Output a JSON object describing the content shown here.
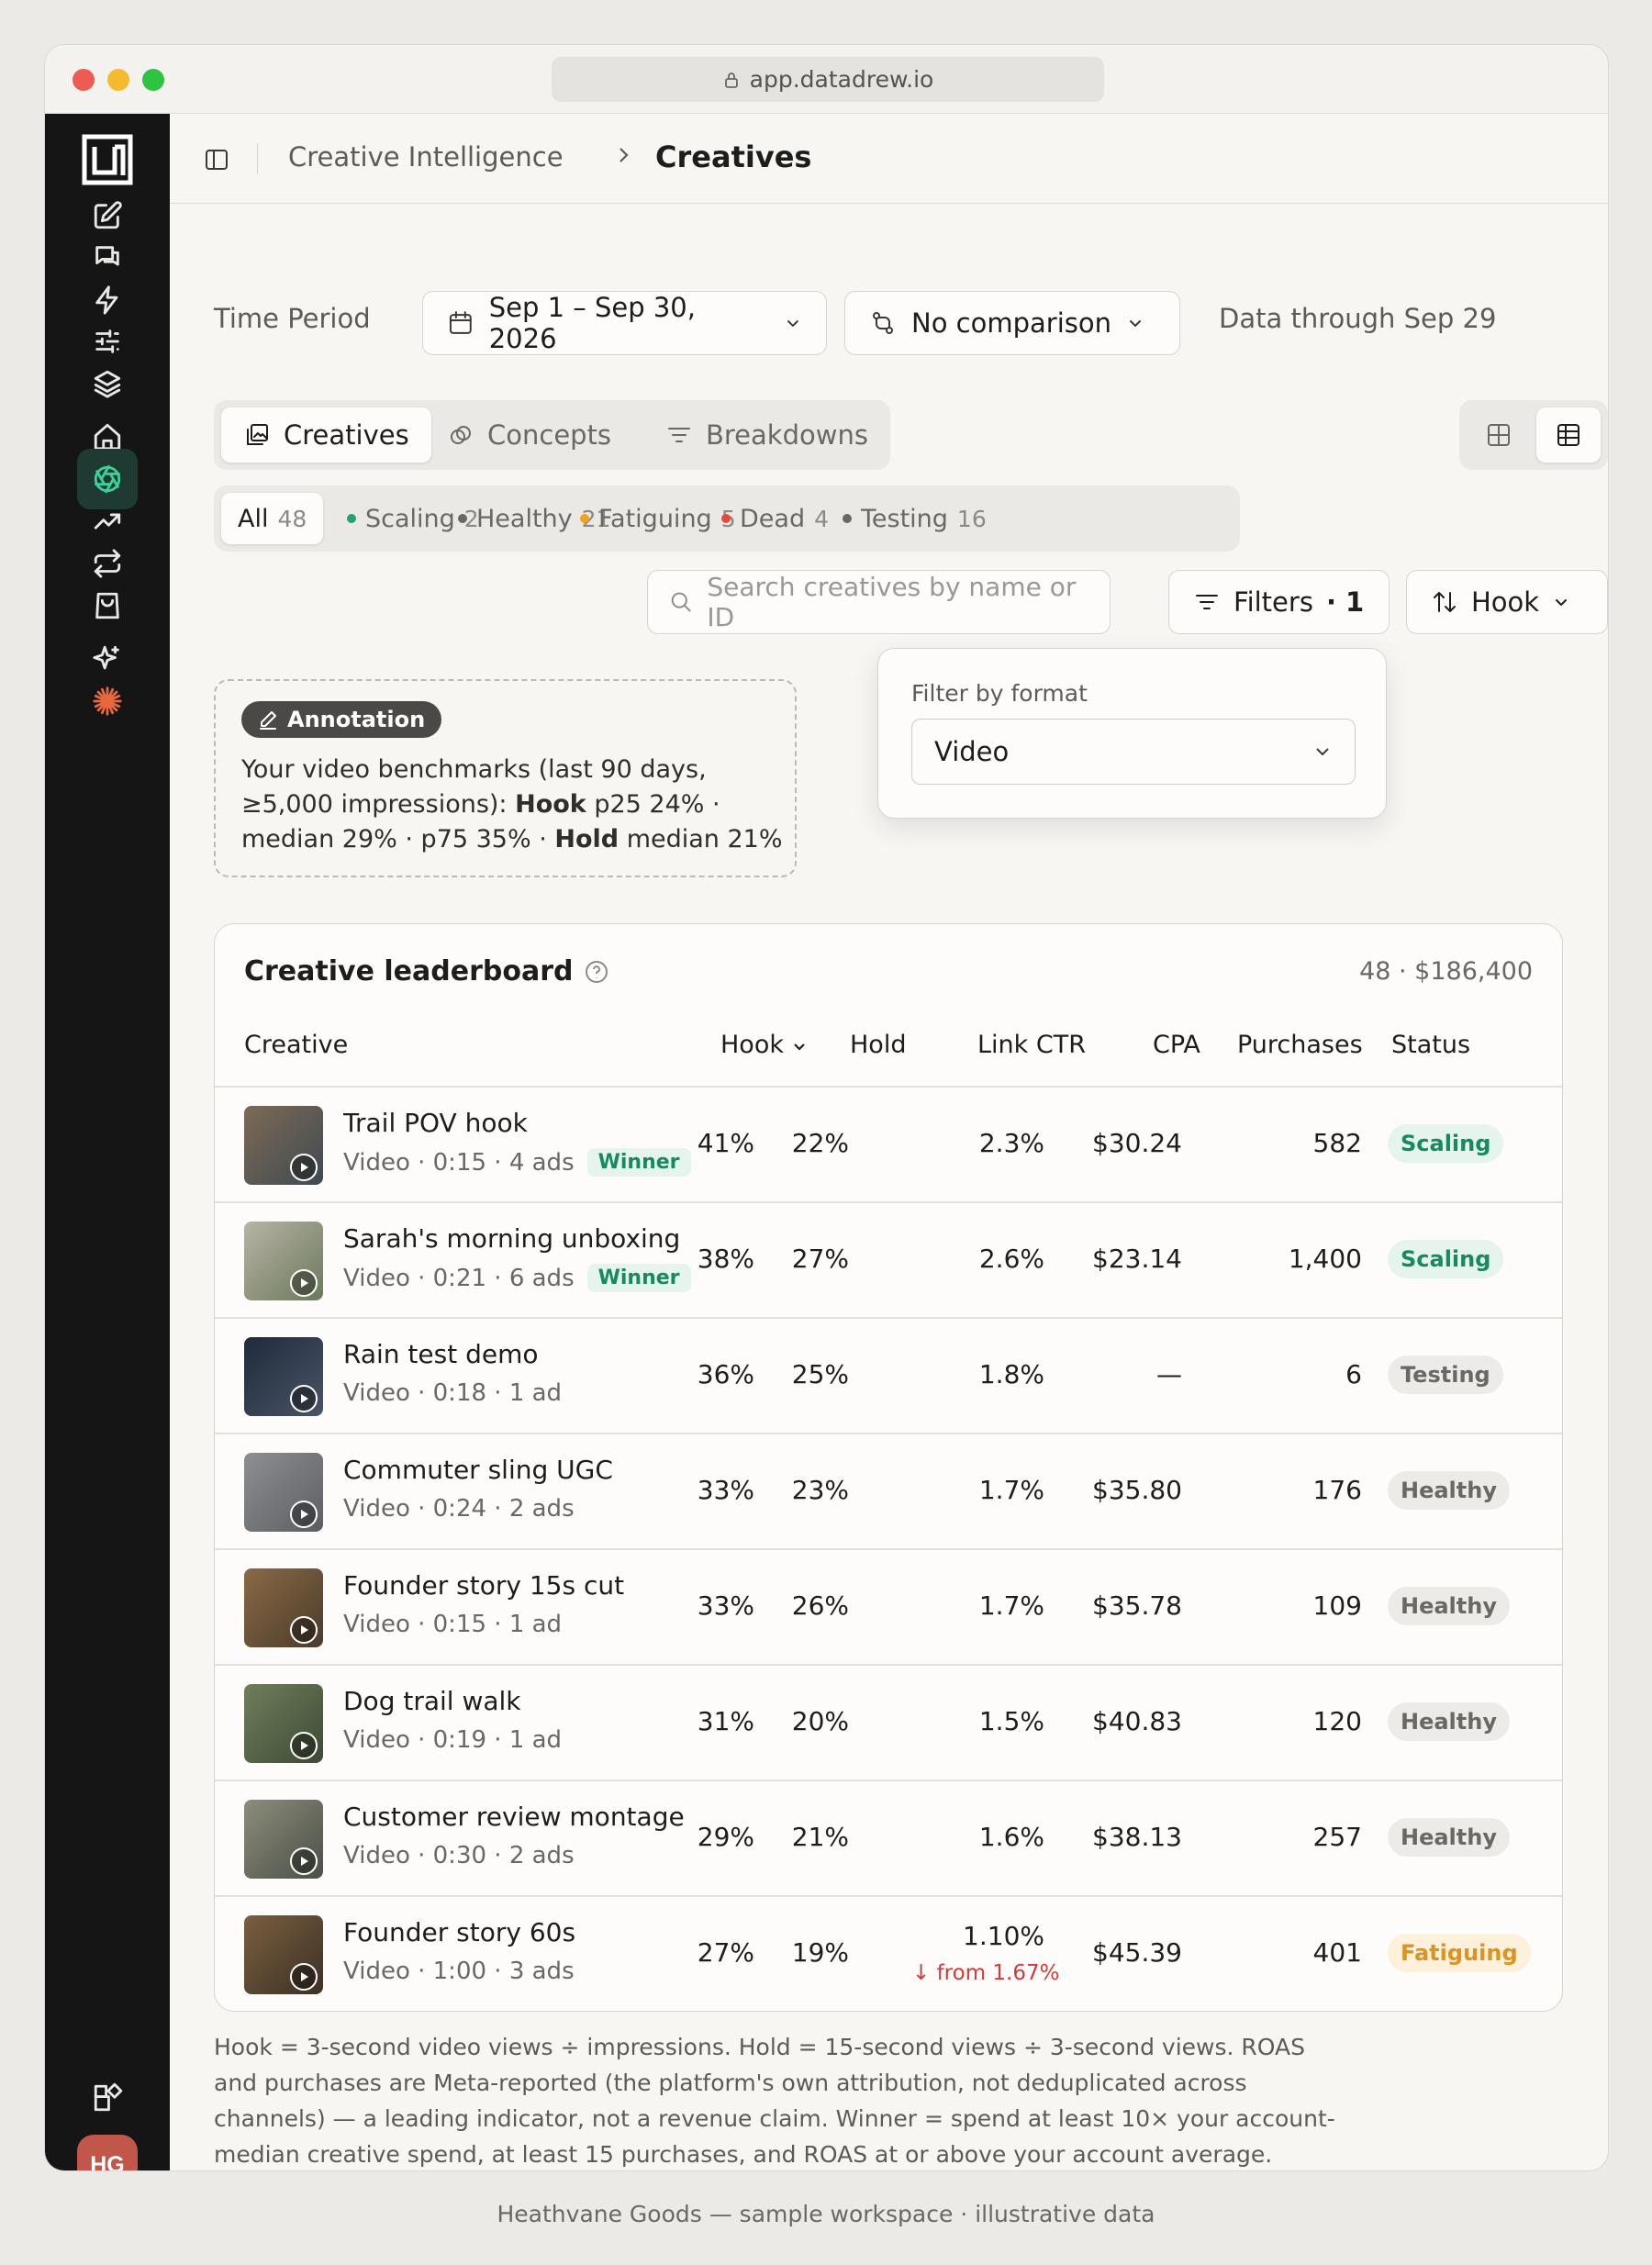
{
  "browser": {
    "url": "app.datadrew.io"
  },
  "sidebar": {
    "icons": [
      "edit-icon",
      "chat-icon",
      "bolt-icon",
      "sliders-icon",
      "layers-icon",
      "home-icon",
      "aperture-icon",
      "trend-icon",
      "repeat-icon",
      "bag-icon",
      "sparkle-icon",
      "asterisk-icon",
      "widgets-icon"
    ],
    "active": "aperture-icon",
    "avatar_initials": "HG"
  },
  "breadcrumb": {
    "parent": "Creative Intelligence",
    "current": "Creatives"
  },
  "controls": {
    "time_period_label": "Time Period",
    "date_range": "Sep 1 – Sep 30, 2026",
    "comparison": "No comparison",
    "data_through": "Data through Sep 29"
  },
  "tabs": [
    {
      "label": "Creatives",
      "icon": "gallery-icon",
      "active": true
    },
    {
      "label": "Concepts",
      "icon": "link-icon",
      "active": false
    },
    {
      "label": "Breakdowns",
      "icon": "filter-icon",
      "active": false
    }
  ],
  "status_filters": [
    {
      "label": "All",
      "count": "48",
      "color": null,
      "active": true
    },
    {
      "label": "Scaling",
      "count": "2",
      "color": "#22a36f",
      "active": false
    },
    {
      "label": "Healthy",
      "count": "21",
      "color": "#6a6864",
      "active": false
    },
    {
      "label": "Fatiguing",
      "count": "5",
      "color": "#f0a21c",
      "active": false
    },
    {
      "label": "Dead",
      "count": "4",
      "color": "#e04a3f",
      "active": false
    },
    {
      "label": "Testing",
      "count": "16",
      "color": "#6a6864",
      "active": false
    }
  ],
  "search": {
    "placeholder": "Search creatives by name or ID"
  },
  "filters_button": {
    "label": "Filters",
    "count": "· 1"
  },
  "sort_button": {
    "label": "Hook"
  },
  "annotation": {
    "badge": "Annotation",
    "text_1": "Your video benchmarks (last 90 days, ≥5,000 impressions): ",
    "hook_label": "Hook",
    "text_2": " p25 24% · median 29% · p75 35% · ",
    "hold_label": "Hold",
    "text_3": " median 21%"
  },
  "filter_popover": {
    "label": "Filter by format",
    "value": "Video"
  },
  "leaderboard": {
    "title": "Creative leaderboard",
    "meta": "48 · $186,400",
    "columns": {
      "creative": "Creative",
      "hook": "Hook",
      "hold": "Hold",
      "link_ctr": "Link CTR",
      "cpa": "CPA",
      "purchases": "Purchases",
      "status": "Status"
    },
    "rows": [
      {
        "name": "Trail POV hook",
        "meta": "Video · 0:15 · 4 ads",
        "badge": "Winner",
        "hook": "41%",
        "hold": "22%",
        "ctr": "2.3%",
        "ctr_delta": "",
        "cpa": "$30.24",
        "purchases": "582",
        "status": "Scaling",
        "thumb": [
          "#7d6a55",
          "#3f4a52"
        ]
      },
      {
        "name": "Sarah's morning unboxing",
        "meta": "Video · 0:21 · 6 ads",
        "badge": "Winner",
        "hook": "38%",
        "hold": "27%",
        "ctr": "2.6%",
        "ctr_delta": "",
        "cpa": "$23.14",
        "purchases": "1,400",
        "status": "Scaling",
        "thumb": [
          "#b8b3a6",
          "#6b7a5a"
        ]
      },
      {
        "name": "Rain test demo",
        "meta": "Video · 0:18 · 1 ad",
        "badge": "",
        "hook": "36%",
        "hold": "25%",
        "ctr": "1.8%",
        "ctr_delta": "",
        "cpa": "—",
        "purchases": "6",
        "status": "Testing",
        "thumb": [
          "#1f2a3a",
          "#4a5468"
        ]
      },
      {
        "name": "Commuter sling UGC",
        "meta": "Video · 0:24 · 2 ads",
        "badge": "",
        "hook": "33%",
        "hold": "23%",
        "ctr": "1.7%",
        "ctr_delta": "",
        "cpa": "$35.80",
        "purchases": "176",
        "status": "Healthy",
        "thumb": [
          "#8d8f92",
          "#5b5e63"
        ]
      },
      {
        "name": "Founder story 15s cut",
        "meta": "Video · 0:15 · 1 ad",
        "badge": "",
        "hook": "33%",
        "hold": "26%",
        "ctr": "1.7%",
        "ctr_delta": "",
        "cpa": "$35.78",
        "purchases": "109",
        "status": "Healthy",
        "thumb": [
          "#8a6a45",
          "#4a3b2c"
        ]
      },
      {
        "name": "Dog trail walk",
        "meta": "Video · 0:19 · 1 ad",
        "badge": "",
        "hook": "31%",
        "hold": "20%",
        "ctr": "1.5%",
        "ctr_delta": "",
        "cpa": "$40.83",
        "purchases": "120",
        "status": "Healthy",
        "thumb": [
          "#6f7f5a",
          "#3e4a35"
        ]
      },
      {
        "name": "Customer review montage",
        "meta": "Video · 0:30 · 2 ads",
        "badge": "",
        "hook": "29%",
        "hold": "21%",
        "ctr": "1.6%",
        "ctr_delta": "",
        "cpa": "$38.13",
        "purchases": "257",
        "status": "Healthy",
        "thumb": [
          "#8c8d7c",
          "#4b4f47"
        ]
      },
      {
        "name": "Founder story 60s",
        "meta": "Video · 1:00 · 3 ads",
        "badge": "",
        "hook": "27%",
        "hold": "19%",
        "ctr": "1.10%",
        "ctr_delta": "↓ from 1.67%",
        "cpa": "$45.39",
        "purchases": "401",
        "status": "Fatiguing",
        "thumb": [
          "#7a5f40",
          "#3d3025"
        ]
      }
    ]
  },
  "footnote": "Hook = 3-second video views ÷ impressions. Hold = 15-second views ÷ 3-second views. ROAS and purchases are Meta-reported (the platform's own attribution, not deduplicated across channels) — a leading indicator, not a revenue claim. Winner = spend at least 10× your account-median creative spend, at least 15 purchases, and ROAS at or above your account average.",
  "caption": "Heathvane Goods — sample workspace · illustrative data"
}
